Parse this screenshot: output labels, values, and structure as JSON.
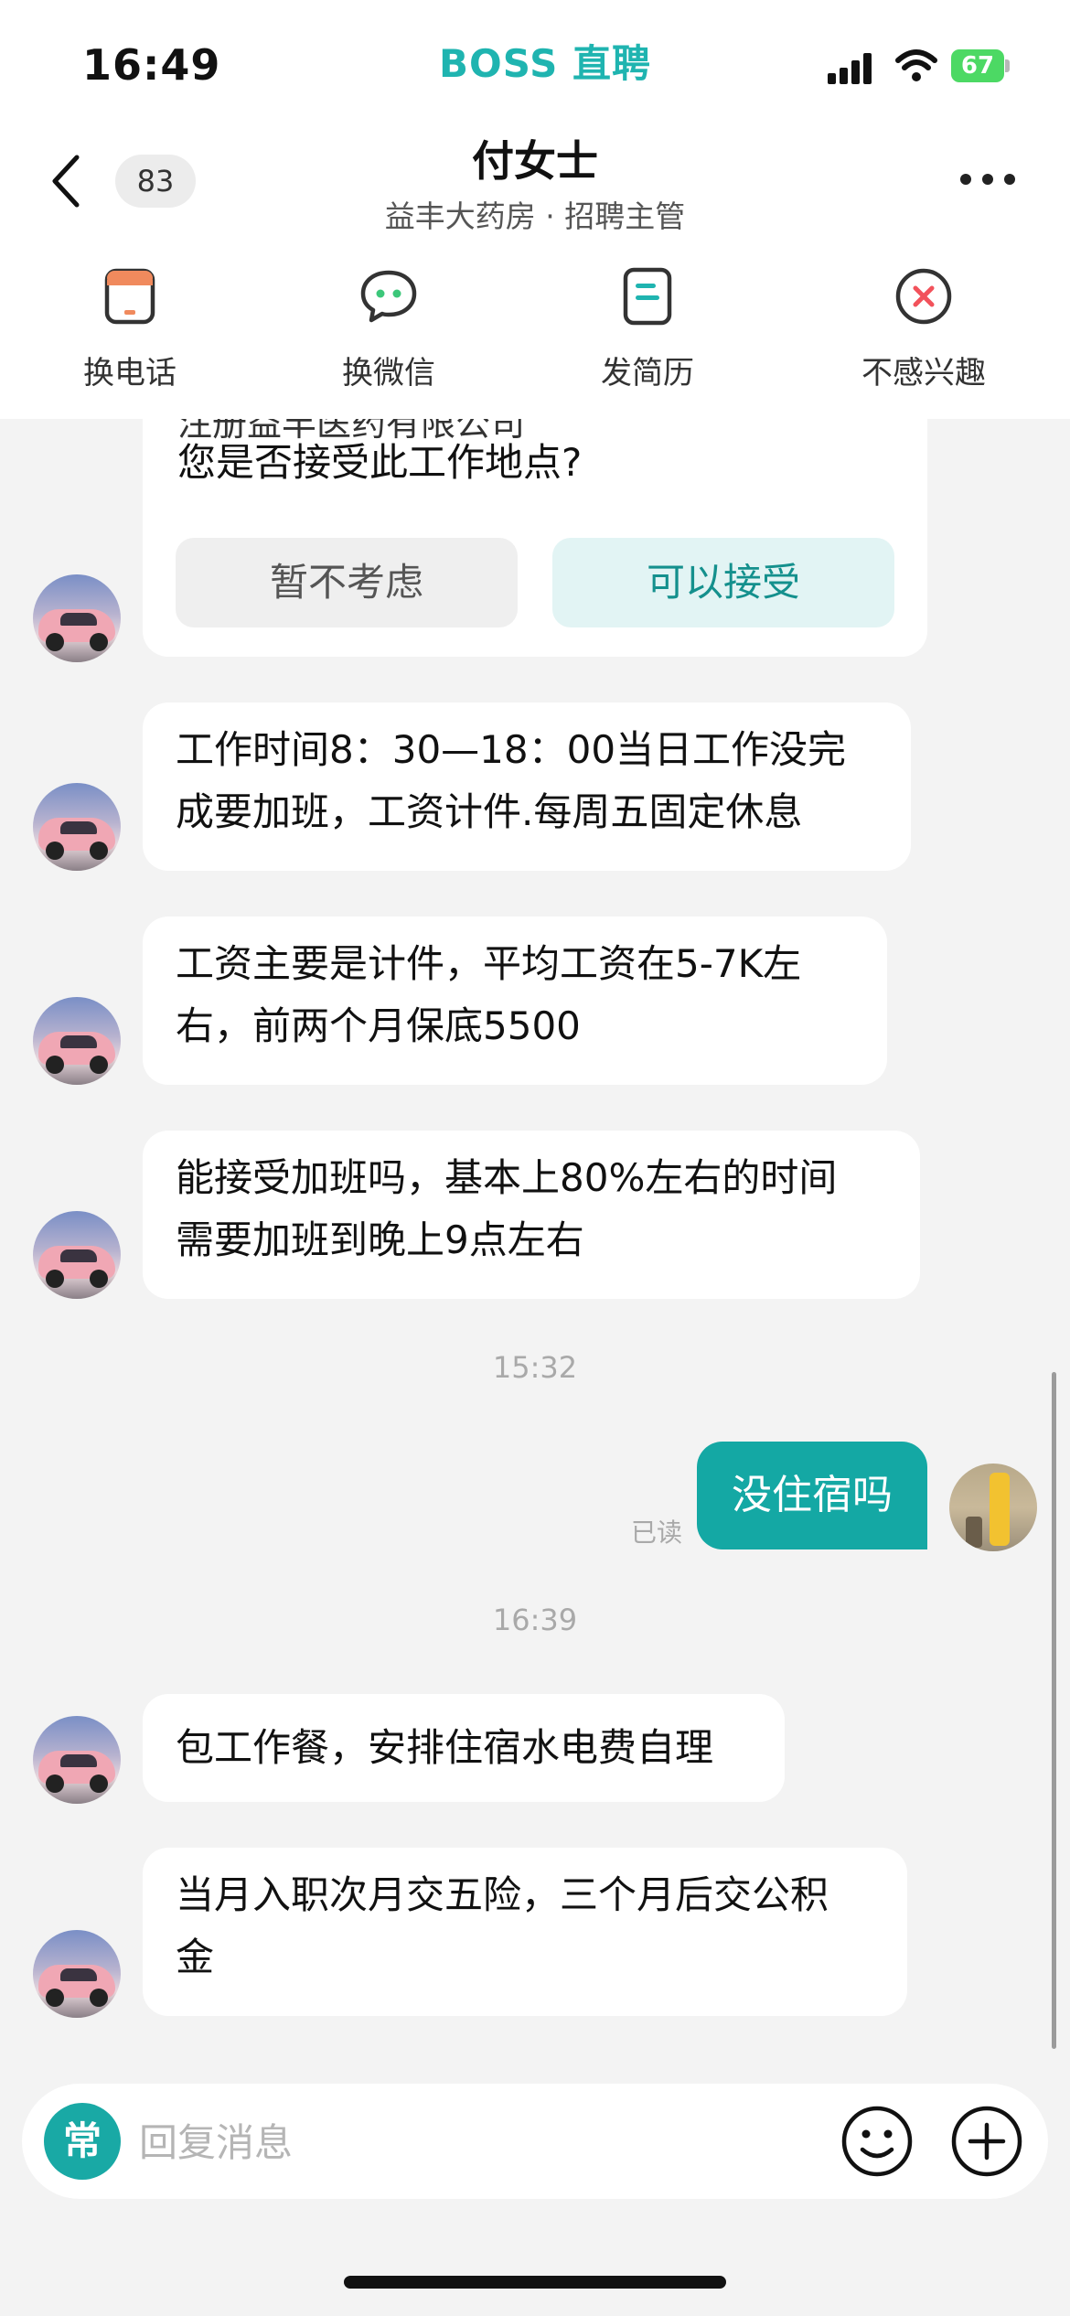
{
  "status_bar": {
    "time": "16:49",
    "brand": "BOSS 直聘",
    "battery": "67"
  },
  "header": {
    "unread_count": "83",
    "name": "付女士",
    "subtitle": "益丰大药房 · 招聘主管"
  },
  "actions": [
    {
      "label": "换电话",
      "icon": "phone-card-icon",
      "color": "#f08a5d"
    },
    {
      "label": "换微信",
      "icon": "wechat-icon",
      "color": "#3cc77a"
    },
    {
      "label": "发简历",
      "icon": "resume-icon",
      "color": "#1fb4b0"
    },
    {
      "label": "不感兴趣",
      "icon": "not-interested-icon",
      "color": "#f2525b"
    }
  ],
  "chat": {
    "location_card": {
      "partial_text": "注册益丰医药有限公司",
      "question": "您是否接受此工作地点?",
      "decline_label": "暂不考虑",
      "accept_label": "可以接受"
    },
    "msg1": {
      "line1": "工作时间8：30—18：00当日工作没完",
      "line2": "成要加班，工资计件.每周五固定休息"
    },
    "msg2": {
      "line1": "工资主要是计件，平均工资在5-7K左",
      "line2": "右，前两个月保底5500"
    },
    "msg3": {
      "line1": "能接受加班吗，基本上80%左右的时间",
      "line2": "需要加班到晚上9点左右"
    },
    "time1": "15:32",
    "my_msg": {
      "text": "没住宿吗",
      "read_status": "已读"
    },
    "time2": "16:39",
    "msg4": {
      "text": "包工作餐，安排住宿水电费自理"
    },
    "msg5": {
      "line1": "当月入职次月交五险，三个月后交公积",
      "line2": "金"
    }
  },
  "input_bar": {
    "common_label": "常",
    "placeholder": "回复消息"
  },
  "colors": {
    "accent": "#1fb4b0",
    "my_bubble": "#14a8a4",
    "accept_bg": "#e2f4f4",
    "decline_bg": "#efefef"
  }
}
